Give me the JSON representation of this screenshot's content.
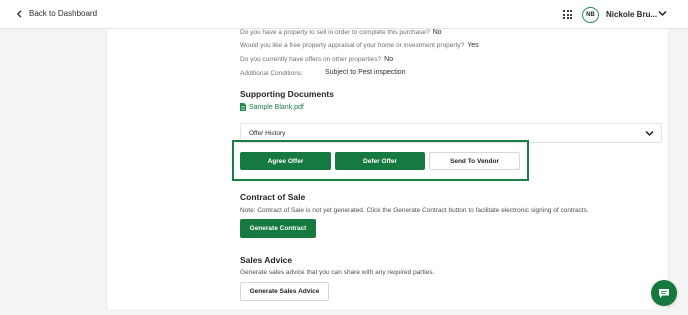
{
  "header": {
    "back_label": "Back to Dashboard",
    "avatar_initials": "NB",
    "user_name": "Nickole Bru..."
  },
  "questions": [
    {
      "label": "Do you have a property to sell in order to complete this purchase?",
      "answer": "No"
    },
    {
      "label": "Would you like a free property appraisal of your home or investment property?",
      "answer": "Yes"
    },
    {
      "label": "Do you currently have offers on other properties?",
      "answer": "No"
    },
    {
      "label": "Additional Conditions:",
      "answer": "Subject to Pest inspection"
    }
  ],
  "supporting_documents": {
    "heading": "Supporting Documents",
    "file_name": "Sample Blank.pdf"
  },
  "offer_history": {
    "label": "Offer History"
  },
  "offer_actions": {
    "agree": "Agree Offer",
    "defer": "Defer Offer",
    "send": "Send To Vendor"
  },
  "contract": {
    "heading": "Contract of Sale",
    "note": "Note: Contract of Sale is not yet generated. Click the Generate Contract button to facilitate electronic signing of contracts.",
    "button": "Generate Contract"
  },
  "sales_advice": {
    "heading": "Sales Advice",
    "note": "Generate sales advice that you can share with any required parties.",
    "button": "Generate Sales Advice"
  },
  "colors": {
    "brand_green": "#16793f",
    "highlight_border": "#1a7d45"
  },
  "icons": [
    "chevron-left-icon",
    "apps-grid-icon",
    "chevron-down-icon",
    "document-icon",
    "chat-icon"
  ]
}
